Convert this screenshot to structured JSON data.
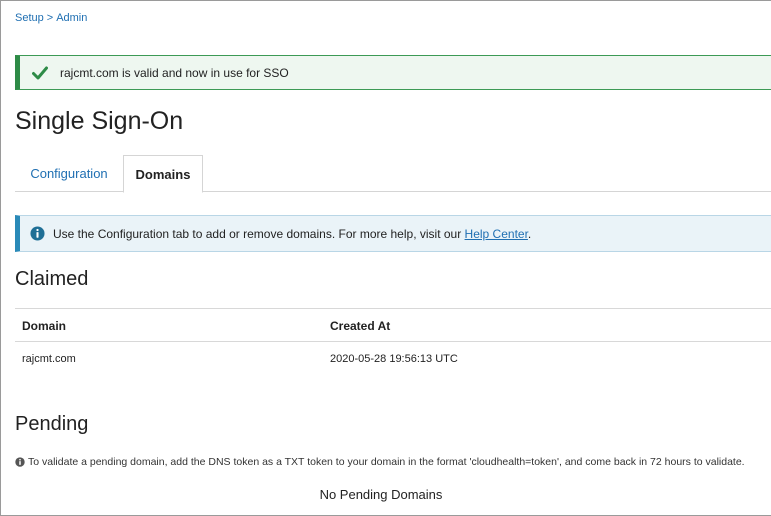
{
  "breadcrumb": {
    "items": [
      "Setup",
      "Admin"
    ],
    "separator": ">"
  },
  "success_banner": {
    "message": "rajcmt.com is valid and now in use for SSO",
    "color": "#2e8b47"
  },
  "page_title": "Single Sign-On",
  "tabs": [
    {
      "label": "Configuration",
      "active": false
    },
    {
      "label": "Domains",
      "active": true
    }
  ],
  "info_banner": {
    "message": "Use the Configuration tab to add or remove domains. For more help, visit our",
    "link_text": "Help Center",
    "suffix": ".",
    "color": "#2a8ab8"
  },
  "claimed": {
    "title": "Claimed",
    "columns": [
      "Domain",
      "Created At"
    ],
    "rows": [
      {
        "domain": "rajcmt.com",
        "created_at": "2020-05-28 19:56:13 UTC"
      }
    ]
  },
  "pending": {
    "title": "Pending",
    "note": "To validate a pending domain, add the DNS token as a TXT token to your domain in the format 'cloudhealth=token', and come back in 72 hours to validate.",
    "empty_message": "No Pending Domains"
  },
  "icons": {
    "success": "check-icon",
    "info": "info-icon"
  }
}
